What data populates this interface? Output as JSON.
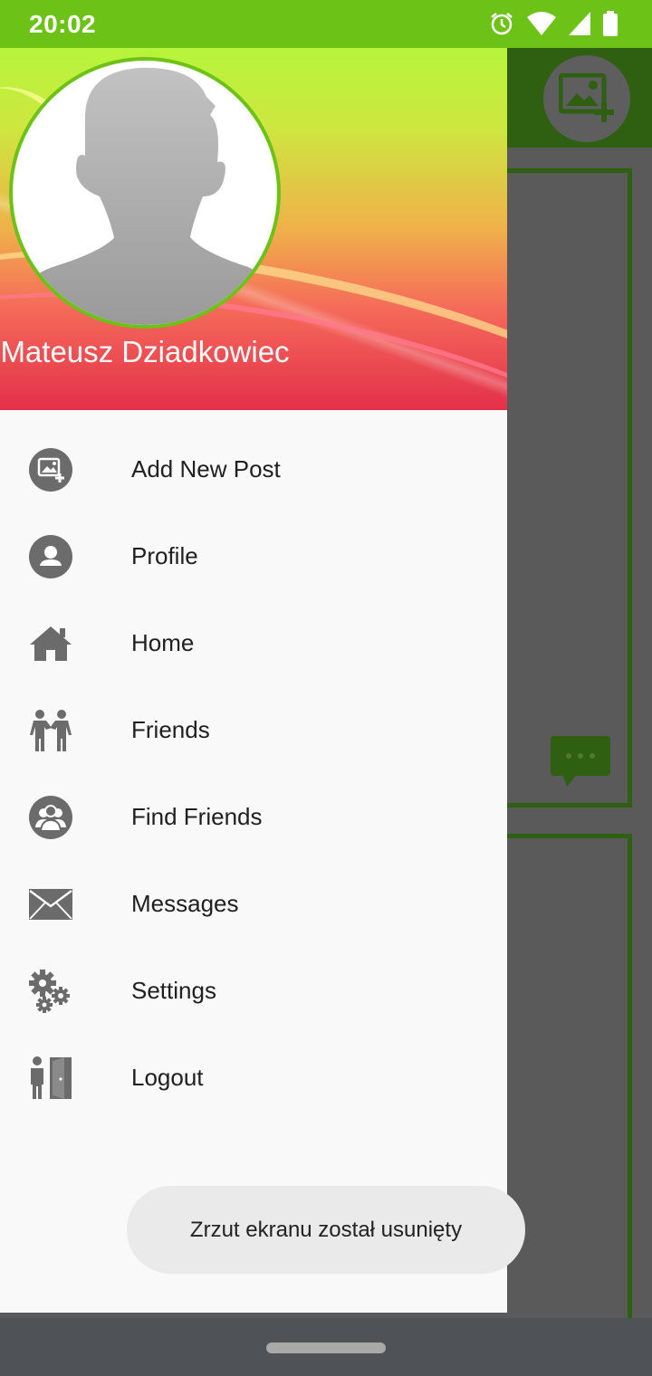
{
  "status_bar": {
    "time": "20:02",
    "icons": [
      "alarm-icon",
      "wifi-icon",
      "signal-icon",
      "battery-icon"
    ]
  },
  "drawer": {
    "profile": {
      "name": "Mateusz Dziadkowiec",
      "avatar": "avatar-placeholder-icon"
    },
    "menu": [
      {
        "label": "Add New Post",
        "icon": "add-image-icon"
      },
      {
        "label": "Profile",
        "icon": "person-icon"
      },
      {
        "label": "Home",
        "icon": "home-icon"
      },
      {
        "label": "Friends",
        "icon": "friends-icon"
      },
      {
        "label": "Find Friends",
        "icon": "find-friends-icon"
      },
      {
        "label": "Messages",
        "icon": "envelope-icon"
      },
      {
        "label": "Settings",
        "icon": "gears-icon"
      },
      {
        "label": "Logout",
        "icon": "logout-door-icon"
      }
    ]
  },
  "toast": {
    "text": "Zrzut ekranu został usunięty"
  },
  "colors": {
    "accent": "#6cc217",
    "toolbar_dark": "#2f5f10",
    "icon_gray": "#6b6b6b"
  }
}
